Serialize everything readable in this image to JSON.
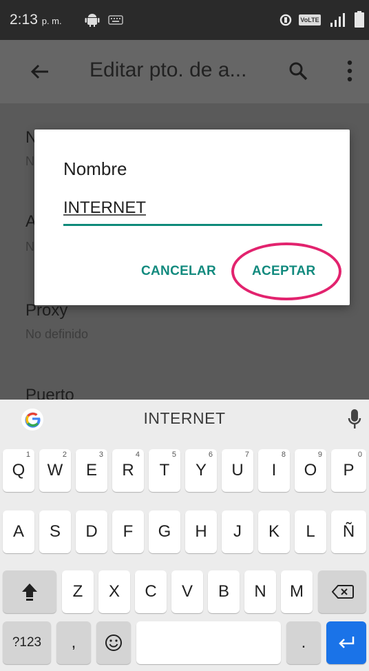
{
  "status_bar": {
    "time": "2:13",
    "ampm": "p. m.",
    "volte": "VoLTE"
  },
  "app_bar": {
    "title": "Editar pto. de a..."
  },
  "settings": {
    "items": [
      {
        "title": "N",
        "summary": "N"
      },
      {
        "title": "A",
        "summary": "N"
      },
      {
        "title": "Proxy",
        "summary": "No definido"
      },
      {
        "title": "Puerto",
        "summary": ""
      }
    ]
  },
  "dialog": {
    "title": "Nombre",
    "input_value": "INTERNET",
    "cancel_label": "CANCELAR",
    "accept_label": "ACEPTAR"
  },
  "colors": {
    "accent": "#128a7e",
    "annotation": "#e2236e",
    "enter_key": "#1a73e8"
  },
  "keyboard": {
    "suggestion": "INTERNET",
    "row1": [
      {
        "label": "Q",
        "hint": "1"
      },
      {
        "label": "W",
        "hint": "2"
      },
      {
        "label": "E",
        "hint": "3"
      },
      {
        "label": "R",
        "hint": "4"
      },
      {
        "label": "T",
        "hint": "5"
      },
      {
        "label": "Y",
        "hint": "6"
      },
      {
        "label": "U",
        "hint": "7"
      },
      {
        "label": "I",
        "hint": "8"
      },
      {
        "label": "O",
        "hint": "9"
      },
      {
        "label": "P",
        "hint": "0"
      }
    ],
    "row2": [
      "A",
      "S",
      "D",
      "F",
      "G",
      "H",
      "J",
      "K",
      "L",
      "Ñ"
    ],
    "row3": [
      "Z",
      "X",
      "C",
      "V",
      "B",
      "N",
      "M"
    ],
    "row4": {
      "symbols_label": "?123",
      "comma": ",",
      "period": "."
    },
    "icons": [
      "google-g-icon",
      "microphone-icon",
      "shift-icon",
      "backspace-icon",
      "emoji-icon",
      "enter-icon"
    ]
  }
}
